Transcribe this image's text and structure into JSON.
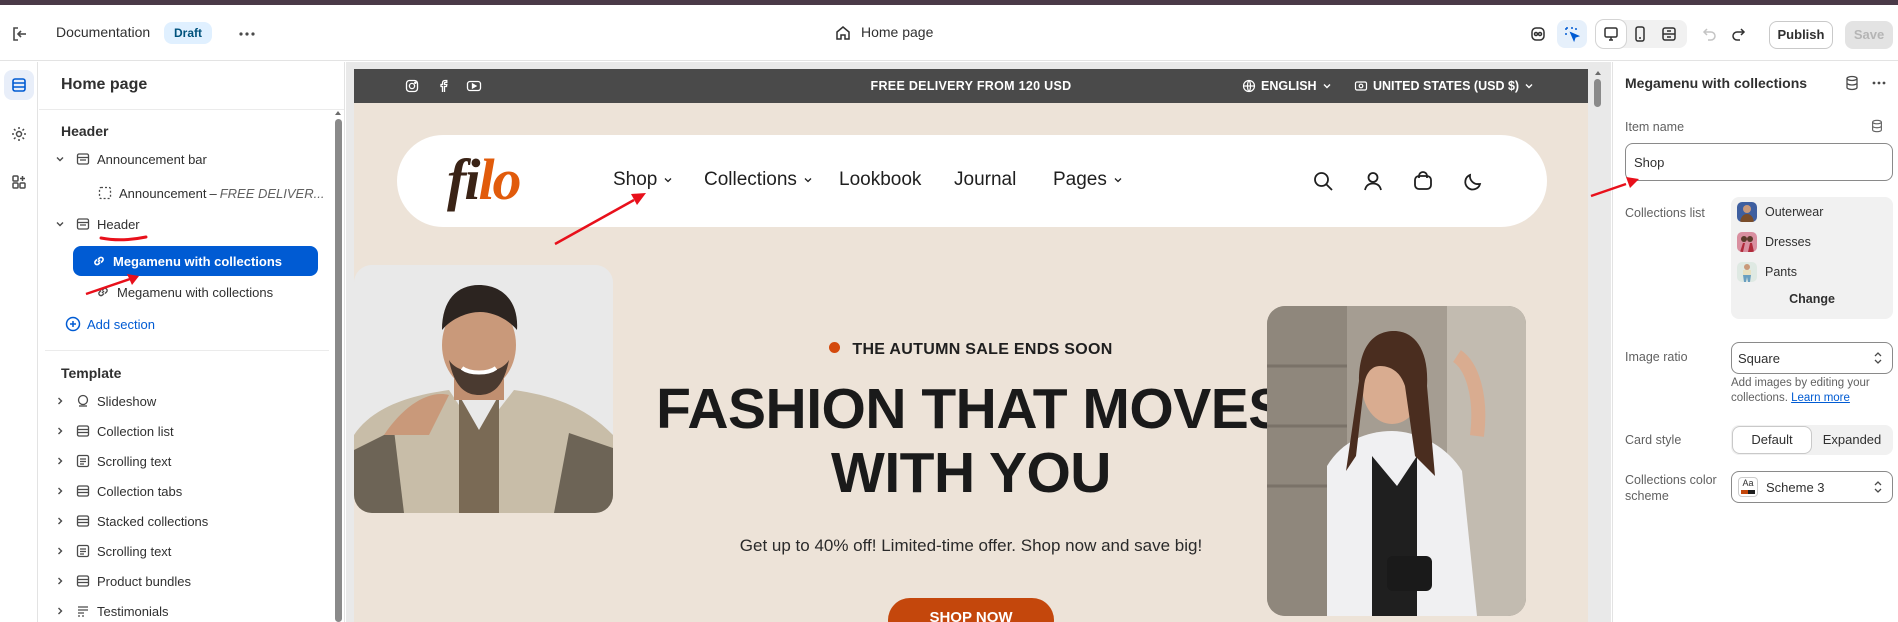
{
  "topbar": {
    "documentation_label": "Documentation",
    "draft_badge": "Draft",
    "page_title": "Home page",
    "publish_label": "Publish",
    "save_label": "Save"
  },
  "left_panel": {
    "title": "Home page",
    "header_group": "Header",
    "header_items": [
      {
        "label": "Announcement bar"
      },
      {
        "label": "Announcement",
        "sublabel": "FREE DELIVER..."
      },
      {
        "label": "Header"
      },
      {
        "label": "Megamenu with collections"
      },
      {
        "label": "Megamenu with collections"
      }
    ],
    "add_section_label": "Add section",
    "template_group": "Template",
    "template_items": [
      {
        "label": "Slideshow"
      },
      {
        "label": "Collection list"
      },
      {
        "label": "Scrolling text"
      },
      {
        "label": "Collection tabs"
      },
      {
        "label": "Stacked collections"
      },
      {
        "label": "Scrolling text"
      },
      {
        "label": "Product bundles"
      },
      {
        "label": "Testimonials"
      }
    ]
  },
  "preview": {
    "announcement_text": "FREE DELIVERY FROM 120 USD",
    "language_label": "ENGLISH",
    "country_label": "UNITED STATES (USD $)",
    "logo_part1": "fi",
    "logo_part2": "lo",
    "nav": {
      "shop": "Shop",
      "collections": "Collections",
      "lookbook": "Lookbook",
      "journal": "Journal",
      "pages": "Pages"
    },
    "hero": {
      "badge": "THE AUTUMN SALE ENDS SOON",
      "title_line1": "FASHION THAT MOVES",
      "title_line2": "WITH YOU",
      "subtitle": "Get up to 40% off! Limited-time offer. Shop now and save big!",
      "cta": "SHOP NOW"
    }
  },
  "right_panel": {
    "title": "Megamenu with collections",
    "item_name_label": "Item name",
    "item_name_value": "Shop",
    "collections_list_label": "Collections list",
    "collections": [
      "Outerwear",
      "Dresses",
      "Pants"
    ],
    "change_label": "Change",
    "image_ratio_label": "Image ratio",
    "image_ratio_value": "Square",
    "help_text": "Add images by editing your collections.",
    "help_link": "Learn more",
    "card_style_label": "Card style",
    "card_style_options": [
      "Default",
      "Expanded"
    ],
    "color_scheme_label": "Collections color scheme",
    "color_scheme_value": "Scheme 3",
    "scheme_swatch_text": "Aa"
  },
  "colors": {
    "accent_blue": "#005bd3",
    "cta_orange": "#c4470c",
    "logo_orange": "#e15b0b",
    "annotation_red": "#e8101b"
  }
}
